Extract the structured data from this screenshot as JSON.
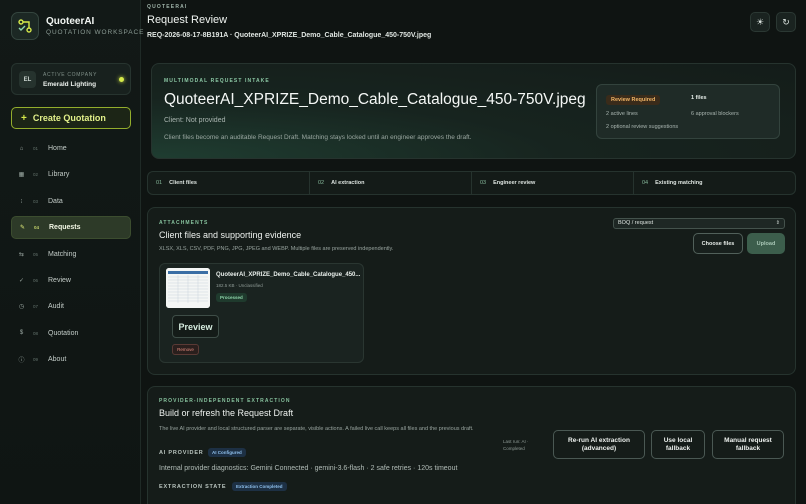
{
  "brand": {
    "name": "QuoteerAI",
    "subtitle": "QUOTATION WORKSPACE"
  },
  "company": {
    "label": "ACTIVE COMPANY",
    "initials": "EL",
    "name": "Emerald Lighting"
  },
  "sidebar": {
    "create_label": "Create Quotation",
    "items": [
      {
        "num": "01",
        "label": "Home",
        "icon": "home-icon",
        "glyph": "⌂",
        "active": false
      },
      {
        "num": "02",
        "label": "Library",
        "icon": "library-icon",
        "glyph": "▦",
        "active": false
      },
      {
        "num": "03",
        "label": "Data",
        "icon": "data-icon",
        "glyph": "⁝",
        "active": false
      },
      {
        "num": "04",
        "label": "Requests",
        "icon": "requests-icon",
        "glyph": "✎",
        "active": true
      },
      {
        "num": "05",
        "label": "Matching",
        "icon": "matching-icon",
        "glyph": "⇆",
        "active": false
      },
      {
        "num": "06",
        "label": "Review",
        "icon": "check-icon",
        "glyph": "✓",
        "active": false
      },
      {
        "num": "07",
        "label": "Audit",
        "icon": "clock-icon",
        "glyph": "◷",
        "active": false
      },
      {
        "num": "08",
        "label": "Quotation",
        "icon": "dollar-icon",
        "glyph": "$",
        "active": false
      },
      {
        "num": "09",
        "label": "About",
        "icon": "info-icon",
        "glyph": "ⓘ",
        "active": false
      }
    ]
  },
  "header": {
    "overline": "QUOTEERAI",
    "title": "Request Review",
    "subtitle": "REQ-2026-08-17-8B191A · QuoteerAI_XPRIZE_Demo_Cable_Catalogue_450-750V.jpeg"
  },
  "hero": {
    "overline": "MULTIMODAL REQUEST INTAKE",
    "title": "QuoteerAI_XPRIZE_Demo_Cable_Catalogue_450-750V.jpeg",
    "client": "Client: Not provided",
    "description": "Client files become an auditable Request Draft. Matching stays locked until an engineer approves the draft.",
    "status_badge": "Review Required",
    "files": "1 files",
    "active_lines": "2 active lines",
    "blockers": "6 approval blockers",
    "optional": "2 optional review suggestions"
  },
  "steps": [
    {
      "num": "01",
      "label": "Client files"
    },
    {
      "num": "02",
      "label": "AI extraction"
    },
    {
      "num": "03",
      "label": "Engineer review"
    },
    {
      "num": "04",
      "label": "Existing matching"
    }
  ],
  "attachments": {
    "overline": "ATTACHMENTS",
    "title": "Client files and supporting evidence",
    "description": "XLSX, XLS, CSV, PDF, PNG, JPG, JPEG and WEBP. Multiple files are preserved independently.",
    "select_value": "BOQ / request",
    "choose_label": "Choose files",
    "upload_label": "Upload",
    "file": {
      "name": "QuoteerAI_XPRIZE_Demo_Cable_Catalogue_450...",
      "meta": "182.5 KB · Unclassified",
      "status": "Processed",
      "preview_label": "Preview",
      "remove_label": "Remove"
    }
  },
  "extraction": {
    "overline": "PROVIDER-INDEPENDENT EXTRACTION",
    "title": "Build or refresh the Request Draft",
    "description": "The live AI provider and local structured parser are separate, visible actions. A failed live call keeps all files and the previous draft.",
    "provider_label": "AI PROVIDER",
    "provider_badge": "AI Configured",
    "diagnostics": "Internal provider diagnostics: Gemini Connected · gemini-3.6-flash · 2 safe retries · 120s timeout",
    "state_label": "EXTRACTION STATE",
    "state_badge": "Extraction Completed",
    "last_run": "Last run: AI · Completed",
    "rerun_label": "Re-run AI extraction (advanced)",
    "local_label": "Use local fallback",
    "manual_label": "Manual request fallback"
  }
}
